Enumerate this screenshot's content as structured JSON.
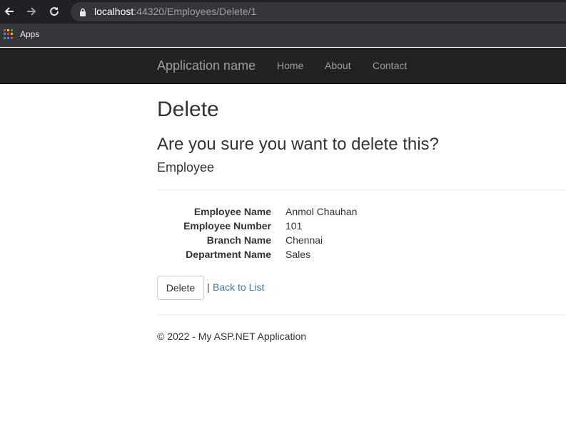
{
  "browser": {
    "url_host": "localhost",
    "url_rest": ":44320/Employees/Delete/1",
    "bookmarks": {
      "apps_label": "Apps"
    },
    "apps_grid_colors": [
      "#ea4335",
      "#fbbc04",
      "#34a853",
      "#4285f4",
      "#ea4335",
      "#fbbc04",
      "#34a853",
      "#4285f4",
      "#ea4335"
    ]
  },
  "navbar": {
    "brand": "Application name",
    "links": [
      "Home",
      "About",
      "Contact"
    ]
  },
  "page": {
    "title": "Delete",
    "confirm": "Are you sure you want to delete this?",
    "entity": "Employee",
    "fields": [
      {
        "label": "Employee Name",
        "value": "Anmol Chauhan"
      },
      {
        "label": "Employee Number",
        "value": "101"
      },
      {
        "label": "Branch Name",
        "value": "Chennai"
      },
      {
        "label": "Department Name",
        "value": "Sales"
      }
    ],
    "delete_button": "Delete",
    "separator": "|",
    "back_link": "Back to List"
  },
  "footer": {
    "text": "© 2022 - My ASP.NET Application"
  },
  "colors": {
    "navbar_bg": "#222222",
    "link": "#337ab7",
    "nav_text": "#9d9d9d"
  }
}
